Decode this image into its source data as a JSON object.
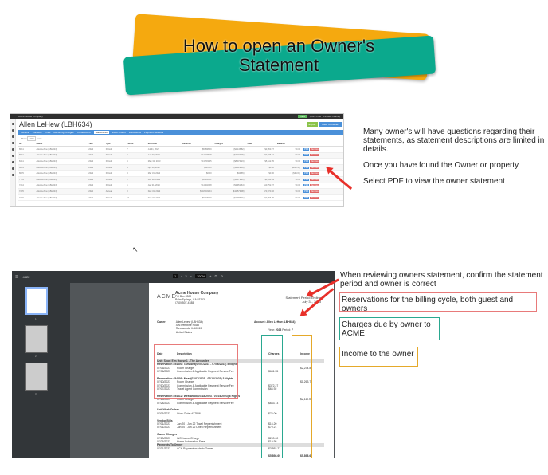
{
  "banner": {
    "title_line1": "How to open an Owner's",
    "title_line2": "Statement"
  },
  "app": {
    "company": "Acme House Company",
    "top_button": "Add",
    "quick_find": "Quick Find",
    "user_menu": "Lindsey Draney",
    "page_title": "Allen LeHew (LBH634)",
    "actions": {
      "export": "Export",
      "back": "Back To Owners"
    },
    "tabs": [
      "General",
      "Contacts",
      "Units",
      "Recurring Charges",
      "Transactions",
      "Statements",
      "Work Orders",
      "Documents",
      "Payment Methods"
    ],
    "active_tab": "Statements",
    "show_label": "Show",
    "show_value": "100",
    "show_suffix": "rows",
    "columns": [
      "Id",
      "Owner",
      "Year",
      "Type",
      "Period",
      "End Date",
      "Revenue",
      "Charges",
      "Paid",
      "Balance",
      ""
    ],
    "rows": [
      {
        "id": "8651",
        "owner": "Allen Lehew (LBH634)",
        "year": "2023",
        "type": "Period",
        "period": "7",
        "end": "Jul 31, 2023",
        "revenue": "$5,898.69",
        "charges": "($2,145.82)",
        "paid": "$3,953.27",
        "balance": "$0.00"
      },
      {
        "id": "8621",
        "owner": "Allen Lehew (LBH634)",
        "year": "2023",
        "type": "Period",
        "period": "6",
        "end": "Jun 30, 2023",
        "revenue": "$12,108.18",
        "charges": "($4,207.06)",
        "paid": "$7,976.10",
        "balance": "$0.00"
      },
      {
        "id": "8451",
        "owner": "Allen Lehew (LBH634)",
        "year": "2023",
        "type": "Period",
        "period": "5",
        "end": "May 31, 2023",
        "revenue": "$13,793.45",
        "charges": "($8,074.23)",
        "paid": "$5,612.35",
        "balance": "$0.00"
      },
      {
        "id": "8239",
        "owner": "Allen Lehew (LBH634)",
        "year": "2023",
        "type": "Period",
        "period": "4",
        "end": "Apr 30, 2023",
        "revenue": "$220.00",
        "charges": "($3,329.83)",
        "paid": "$0.00",
        "balance": "($840.93)"
      },
      {
        "id": "8025",
        "owner": "Allen Lehew (LBH634)",
        "year": "2023",
        "type": "Period",
        "period": "3",
        "end": "Mar 31, 2023",
        "revenue": "$0.00",
        "charges": "($34.65)",
        "paid": "$0.00",
        "balance": "($34.65)"
      },
      {
        "id": "7784",
        "owner": "Allen Lehew (LBH634)",
        "year": "2023",
        "type": "Period",
        "period": "2",
        "end": "Feb 28, 2023",
        "revenue": "$5,162.01",
        "charges": "($1,179.20)",
        "paid": "$3,034.89",
        "balance": "$0.00"
      },
      {
        "id": "7254",
        "owner": "Allen Lehew (LBH634)",
        "year": "2023",
        "type": "Period",
        "period": "1",
        "end": "Jan 31, 2023",
        "revenue": "$14,440.68",
        "charges": "($3,951.64)",
        "paid": "$10,752.37",
        "balance": "$0.00"
      },
      {
        "id": "7235",
        "owner": "Allen Lehew (LBH634)",
        "year": "2022",
        "type": "Annual",
        "period": "0",
        "end": "Dec 31, 2022",
        "revenue": "$318,049.64",
        "charges": "($42,573.08)",
        "paid": "$73,070.46",
        "balance": "$0.00"
      },
      {
        "id": "7230",
        "owner": "Allen Lehew (LBH634)",
        "year": "2022",
        "type": "Period",
        "period": "12",
        "end": "Dec 31, 2022",
        "revenue": "$6,235.29",
        "charges": "($2,786.01)",
        "paid": "$3,456.85",
        "balance": "$0.00"
      }
    ],
    "pdf_label": "PDF",
    "delete_label": "Remove"
  },
  "instructions": [
    "Many owner's will have questions regarding their statements, as statement descriptions are limited in details.",
    "Once you have found the Owner or property",
    "Select PDF to view the owner statement"
  ],
  "viewer": {
    "doc_title": "4822",
    "page_current": "1",
    "page_total": "3",
    "zoom": "100%",
    "thumbnails": [
      "1",
      "2",
      "3"
    ],
    "statement": {
      "logo": "ACME",
      "company": "Acme House Company",
      "address": [
        "PO Box 2800",
        "Palm Springs, CA 92263",
        "(760) 507-4188"
      ],
      "period_label": "Statement Period Ending",
      "period_date": "July 31, 2023",
      "owner_label": "Owner:",
      "owner_lines": [
        "Allen Lehew (LBH634)",
        "426 Pembine Road",
        "Riverwoods, IL 60015",
        "United States"
      ],
      "account": "Account: Allen LeHew (LBH634)",
      "year_label": "Year:",
      "year": "2023",
      "period_field_label": "Period:",
      "period": "7",
      "col_date": "Date",
      "col_desc": "Description",
      "col_charges": "Charges",
      "col_income": "Income",
      "lines": [
        {
          "kind": "section",
          "desc": "Unit: Short Elm House 1 - The Alexander"
        },
        {
          "kind": "head",
          "desc": "Reservation #54800: Tamasha(07/01/2023 - 07/06/2023) 5 Nights"
        },
        {
          "kind": "line",
          "date": "07/06/2023",
          "desc": "Room Charge",
          "charge": "",
          "income": "$2,234.85"
        },
        {
          "kind": "line",
          "date": "07/06/2023",
          "desc": "Commission & Applicable Payment Service Fee",
          "charge": "$681.55",
          "income": ""
        },
        {
          "kind": "blank"
        },
        {
          "kind": "head",
          "desc": "Reservation #54809: Mead(07/07/2023 - 07/10/2023) 3 Nights"
        },
        {
          "kind": "line",
          "date": "07/10/2023",
          "desc": "Room Charge",
          "charge": "",
          "income": "$1,263.74"
        },
        {
          "kind": "line",
          "date": "07/10/2023",
          "desc": "Commission & Applicable Payment Service Fee",
          "charge": "$372.27",
          "income": ""
        },
        {
          "kind": "line",
          "date": "07/07/2023",
          "desc": "Travel Agent Commission",
          "charge": "$64.92",
          "income": ""
        },
        {
          "kind": "blank"
        },
        {
          "kind": "head",
          "desc": "Reservation #54812: Westwood(07/18/2023 - 07/24/2023) 6 Nights"
        },
        {
          "kind": "line",
          "date": "07/24/2023",
          "desc": "Room Charge",
          "charge": "",
          "income": "$2,110.58"
        },
        {
          "kind": "line",
          "date": "07/24/2023",
          "desc": "Commission & Applicable Payment Service Fee",
          "charge": "$643.73",
          "income": ""
        },
        {
          "kind": "blank"
        },
        {
          "kind": "head",
          "desc": "Unit Work Orders"
        },
        {
          "kind": "line",
          "date": "07/06/2023",
          "desc": "Work Order #37856",
          "charge": "$75.00",
          "income": ""
        },
        {
          "kind": "blank"
        },
        {
          "kind": "head",
          "desc": "Vendor Bills"
        },
        {
          "kind": "line",
          "date": "07/01/2023",
          "desc": "Jun 20 - Jun 22 Towel Replenishment",
          "charge": "$16.20",
          "income": ""
        },
        {
          "kind": "line",
          "date": "07/01/2023",
          "desc": "Jun 20 - Jun 22 Linen Replenishment",
          "charge": "$70.21",
          "income": ""
        },
        {
          "kind": "blank"
        },
        {
          "kind": "head",
          "desc": "Owner Charges"
        },
        {
          "kind": "line",
          "date": "07/10/2023",
          "desc": "WCI Labor Charge",
          "charge": "$200.00",
          "income": ""
        },
        {
          "kind": "line",
          "date": "07/25/2023",
          "desc": "Home Automation Fees",
          "charge": "$19.95",
          "income": ""
        },
        {
          "kind": "section",
          "desc": "Payments To Owner"
        },
        {
          "kind": "line",
          "date": "07/31/2023",
          "desc": "ACH Payment made to Owner",
          "charge": "$3,953.27",
          "income": ""
        },
        {
          "kind": "blank"
        },
        {
          "kind": "total",
          "date": "",
          "desc": "",
          "charge": "$5,898.69",
          "income": "$5,898.69"
        }
      ]
    }
  },
  "notes": {
    "confirm": "When reviewing owners statement, confirm the statement period and owner is correct",
    "reservations": "Reservations for the billing cycle, both guest and owners",
    "charges": "Charges due by owner to ACME",
    "income": "Income to the owner"
  },
  "colors": {
    "reservations": "#e87a7a",
    "charges": "#2aa890",
    "income": "#e5a92a",
    "arrow": "#e8302a"
  }
}
